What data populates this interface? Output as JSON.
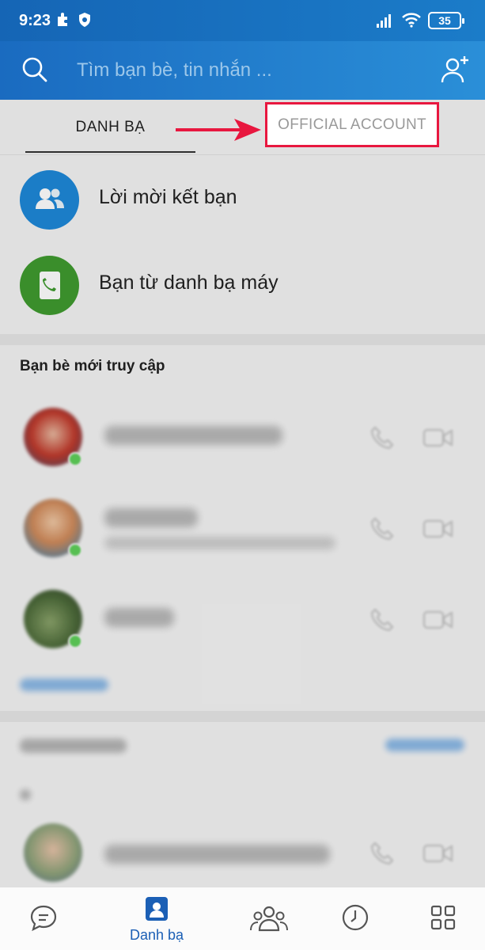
{
  "status_bar": {
    "time": "9:23",
    "battery": "35"
  },
  "search": {
    "placeholder": "Tìm bạn bè, tin nhắn ..."
  },
  "tabs": [
    {
      "label": "DANH BẠ",
      "active": true
    },
    {
      "label": "OFFICIAL ACCOUNT",
      "active": false,
      "highlighted": true
    }
  ],
  "quick_actions": [
    {
      "label": "Lời mời kết bạn",
      "icon": "people-icon",
      "color": "#1e88d8"
    },
    {
      "label": "Bạn từ danh bạ máy",
      "icon": "phonebook-icon",
      "color": "#3f9b2f"
    }
  ],
  "recent_section": {
    "title": "Bạn bè mới truy cập"
  },
  "bottom_nav": [
    {
      "name": "messages",
      "icon": "chat-bubble-icon",
      "label": ""
    },
    {
      "name": "contacts",
      "icon": "contacts-icon",
      "label": "Danh bạ",
      "active": true
    },
    {
      "name": "groups",
      "icon": "group-icon",
      "label": ""
    },
    {
      "name": "timeline",
      "icon": "clock-icon",
      "label": ""
    },
    {
      "name": "more",
      "icon": "grid-icon",
      "label": ""
    }
  ],
  "colors": {
    "accent": "#1b5fb5",
    "header": "#1a6bc0",
    "highlight": "#e8173f"
  }
}
